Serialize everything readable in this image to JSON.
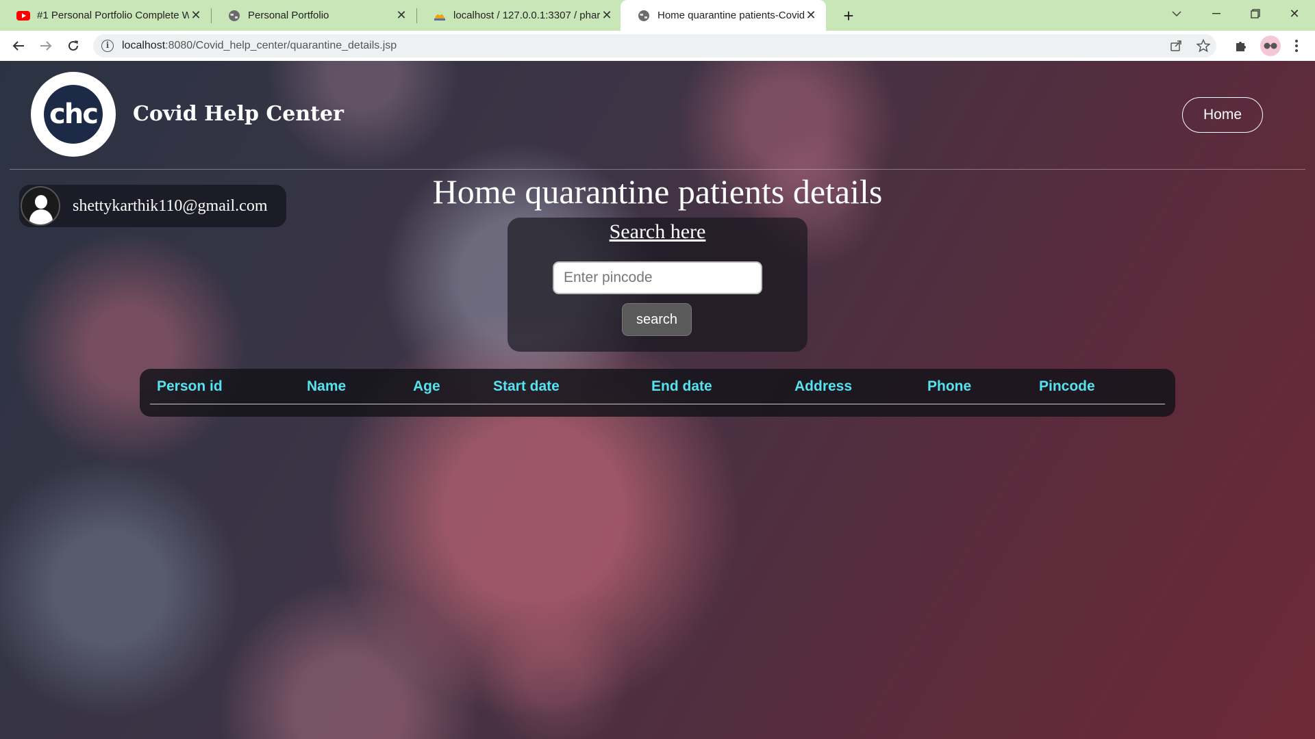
{
  "browser": {
    "tabs": [
      {
        "title": "#1 Personal Portfolio Complete W",
        "favicon": "youtube-icon",
        "active": false
      },
      {
        "title": "Personal Portfolio",
        "favicon": "globe-icon",
        "active": false
      },
      {
        "title": "localhost / 127.0.0.1:3307 / pharm",
        "favicon": "phpmyadmin-icon",
        "active": false
      },
      {
        "title": "Home quarantine patients-Covid",
        "favicon": "globe-icon",
        "active": true
      }
    ],
    "url_host": "localhost",
    "url_path": ":8080/Covid_help_center/quarantine_details.jsp"
  },
  "site": {
    "logo_text": "chc",
    "brand_name": "Covid Help Center",
    "nav_home": "Home"
  },
  "user": {
    "email": "shettykarthik110@gmail.com"
  },
  "page": {
    "title": "Home quarantine patients details"
  },
  "search": {
    "heading": "Search here",
    "placeholder": "Enter pincode",
    "button_label": "search"
  },
  "table": {
    "columns": [
      "Person id",
      "Name",
      "Age",
      "Start date",
      "End date",
      "Address",
      "Phone",
      "Pincode"
    ],
    "rows": []
  },
  "colors": {
    "table_header_text": "#55e3ef",
    "tab_bar": "#c9e6b9"
  }
}
